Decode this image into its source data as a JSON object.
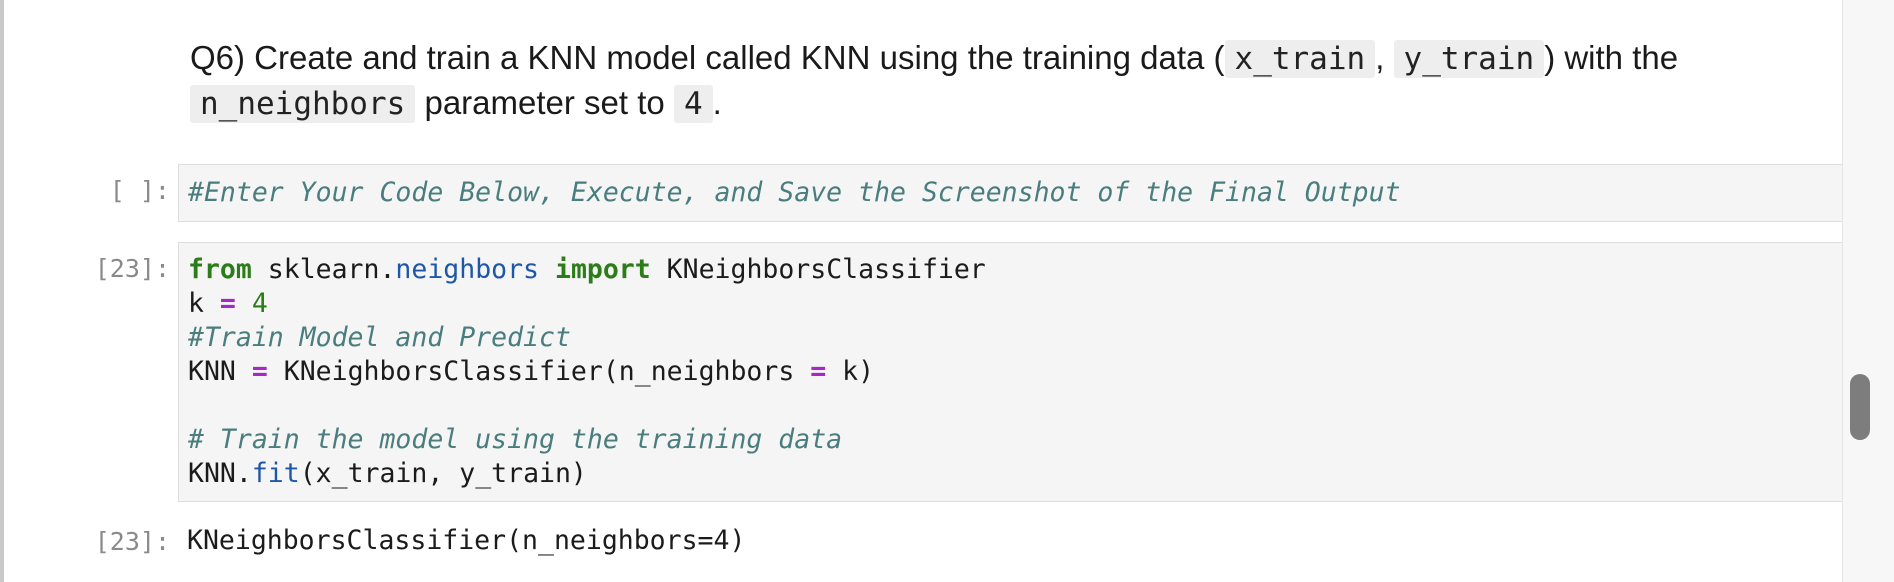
{
  "markdown": {
    "parts": [
      {
        "type": "text",
        "value": "Q6) Create and train a KNN model called KNN using the training data ("
      },
      {
        "type": "code",
        "value": "x_train"
      },
      {
        "type": "text",
        "value": ", "
      },
      {
        "type": "code",
        "value": "y_train"
      },
      {
        "type": "text",
        "value": ") with the "
      },
      {
        "type": "code",
        "value": "n_neighbors"
      },
      {
        "type": "text",
        "value": " parameter set to "
      },
      {
        "type": "code",
        "value": "4"
      },
      {
        "type": "text",
        "value": "."
      }
    ]
  },
  "cells": [
    {
      "prompt": "[ ]:",
      "lines": [
        [
          {
            "t": "cm",
            "v": "#Enter Your Code Below, Execute, and Save the Screenshot of the Final Output"
          }
        ]
      ]
    },
    {
      "prompt": "[23]:",
      "lines": [
        [
          {
            "t": "kw",
            "v": "from"
          },
          {
            "t": "plain",
            "v": " sklearn."
          },
          {
            "t": "mod",
            "v": "neighbors"
          },
          {
            "t": "plain",
            "v": " "
          },
          {
            "t": "kw",
            "v": "import"
          },
          {
            "t": "plain",
            "v": " KNeighborsClassifier"
          }
        ],
        [
          {
            "t": "plain",
            "v": "k "
          },
          {
            "t": "op",
            "v": "="
          },
          {
            "t": "plain",
            "v": " "
          },
          {
            "t": "num",
            "v": "4"
          }
        ],
        [
          {
            "t": "cm",
            "v": "#Train Model and Predict"
          }
        ],
        [
          {
            "t": "plain",
            "v": "KNN "
          },
          {
            "t": "op",
            "v": "="
          },
          {
            "t": "plain",
            "v": " KNeighborsClassifier(n_neighbors "
          },
          {
            "t": "op",
            "v": "="
          },
          {
            "t": "plain",
            "v": " k)"
          }
        ],
        [],
        [
          {
            "t": "cm",
            "v": "# Train the model using the training data"
          }
        ],
        [
          {
            "t": "plain",
            "v": "KNN."
          },
          {
            "t": "fn",
            "v": "fit"
          },
          {
            "t": "plain",
            "v": "(x_train, y_train)"
          }
        ]
      ]
    }
  ],
  "output": {
    "prompt": "[23]:",
    "text": "KNeighborsClassifier(n_neighbors=4)"
  }
}
